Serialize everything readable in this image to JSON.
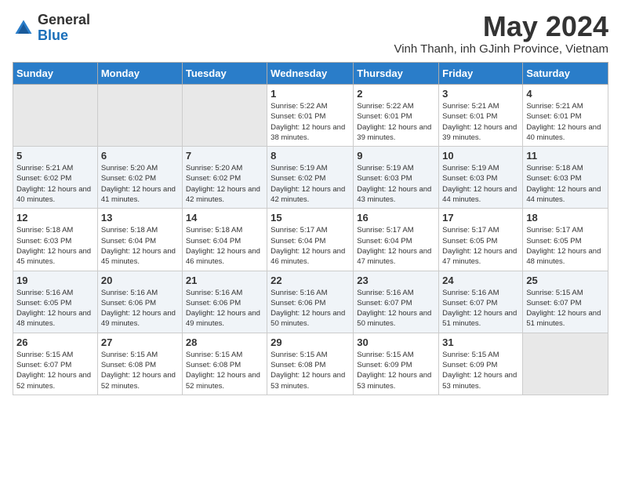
{
  "logo": {
    "general": "General",
    "blue": "Blue"
  },
  "header": {
    "month_title": "May 2024",
    "location": "Vinh Thanh, inh GJinh Province, Vietnam"
  },
  "weekdays": [
    "Sunday",
    "Monday",
    "Tuesday",
    "Wednesday",
    "Thursday",
    "Friday",
    "Saturday"
  ],
  "weeks": [
    [
      {
        "day": "",
        "sunrise": "",
        "sunset": "",
        "daylight": ""
      },
      {
        "day": "",
        "sunrise": "",
        "sunset": "",
        "daylight": ""
      },
      {
        "day": "",
        "sunrise": "",
        "sunset": "",
        "daylight": ""
      },
      {
        "day": "1",
        "sunrise": "Sunrise: 5:22 AM",
        "sunset": "Sunset: 6:01 PM",
        "daylight": "Daylight: 12 hours and 38 minutes."
      },
      {
        "day": "2",
        "sunrise": "Sunrise: 5:22 AM",
        "sunset": "Sunset: 6:01 PM",
        "daylight": "Daylight: 12 hours and 39 minutes."
      },
      {
        "day": "3",
        "sunrise": "Sunrise: 5:21 AM",
        "sunset": "Sunset: 6:01 PM",
        "daylight": "Daylight: 12 hours and 39 minutes."
      },
      {
        "day": "4",
        "sunrise": "Sunrise: 5:21 AM",
        "sunset": "Sunset: 6:01 PM",
        "daylight": "Daylight: 12 hours and 40 minutes."
      }
    ],
    [
      {
        "day": "5",
        "sunrise": "Sunrise: 5:21 AM",
        "sunset": "Sunset: 6:02 PM",
        "daylight": "Daylight: 12 hours and 40 minutes."
      },
      {
        "day": "6",
        "sunrise": "Sunrise: 5:20 AM",
        "sunset": "Sunset: 6:02 PM",
        "daylight": "Daylight: 12 hours and 41 minutes."
      },
      {
        "day": "7",
        "sunrise": "Sunrise: 5:20 AM",
        "sunset": "Sunset: 6:02 PM",
        "daylight": "Daylight: 12 hours and 42 minutes."
      },
      {
        "day": "8",
        "sunrise": "Sunrise: 5:19 AM",
        "sunset": "Sunset: 6:02 PM",
        "daylight": "Daylight: 12 hours and 42 minutes."
      },
      {
        "day": "9",
        "sunrise": "Sunrise: 5:19 AM",
        "sunset": "Sunset: 6:03 PM",
        "daylight": "Daylight: 12 hours and 43 minutes."
      },
      {
        "day": "10",
        "sunrise": "Sunrise: 5:19 AM",
        "sunset": "Sunset: 6:03 PM",
        "daylight": "Daylight: 12 hours and 44 minutes."
      },
      {
        "day": "11",
        "sunrise": "Sunrise: 5:18 AM",
        "sunset": "Sunset: 6:03 PM",
        "daylight": "Daylight: 12 hours and 44 minutes."
      }
    ],
    [
      {
        "day": "12",
        "sunrise": "Sunrise: 5:18 AM",
        "sunset": "Sunset: 6:03 PM",
        "daylight": "Daylight: 12 hours and 45 minutes."
      },
      {
        "day": "13",
        "sunrise": "Sunrise: 5:18 AM",
        "sunset": "Sunset: 6:04 PM",
        "daylight": "Daylight: 12 hours and 45 minutes."
      },
      {
        "day": "14",
        "sunrise": "Sunrise: 5:18 AM",
        "sunset": "Sunset: 6:04 PM",
        "daylight": "Daylight: 12 hours and 46 minutes."
      },
      {
        "day": "15",
        "sunrise": "Sunrise: 5:17 AM",
        "sunset": "Sunset: 6:04 PM",
        "daylight": "Daylight: 12 hours and 46 minutes."
      },
      {
        "day": "16",
        "sunrise": "Sunrise: 5:17 AM",
        "sunset": "Sunset: 6:04 PM",
        "daylight": "Daylight: 12 hours and 47 minutes."
      },
      {
        "day": "17",
        "sunrise": "Sunrise: 5:17 AM",
        "sunset": "Sunset: 6:05 PM",
        "daylight": "Daylight: 12 hours and 47 minutes."
      },
      {
        "day": "18",
        "sunrise": "Sunrise: 5:17 AM",
        "sunset": "Sunset: 6:05 PM",
        "daylight": "Daylight: 12 hours and 48 minutes."
      }
    ],
    [
      {
        "day": "19",
        "sunrise": "Sunrise: 5:16 AM",
        "sunset": "Sunset: 6:05 PM",
        "daylight": "Daylight: 12 hours and 48 minutes."
      },
      {
        "day": "20",
        "sunrise": "Sunrise: 5:16 AM",
        "sunset": "Sunset: 6:06 PM",
        "daylight": "Daylight: 12 hours and 49 minutes."
      },
      {
        "day": "21",
        "sunrise": "Sunrise: 5:16 AM",
        "sunset": "Sunset: 6:06 PM",
        "daylight": "Daylight: 12 hours and 49 minutes."
      },
      {
        "day": "22",
        "sunrise": "Sunrise: 5:16 AM",
        "sunset": "Sunset: 6:06 PM",
        "daylight": "Daylight: 12 hours and 50 minutes."
      },
      {
        "day": "23",
        "sunrise": "Sunrise: 5:16 AM",
        "sunset": "Sunset: 6:07 PM",
        "daylight": "Daylight: 12 hours and 50 minutes."
      },
      {
        "day": "24",
        "sunrise": "Sunrise: 5:16 AM",
        "sunset": "Sunset: 6:07 PM",
        "daylight": "Daylight: 12 hours and 51 minutes."
      },
      {
        "day": "25",
        "sunrise": "Sunrise: 5:15 AM",
        "sunset": "Sunset: 6:07 PM",
        "daylight": "Daylight: 12 hours and 51 minutes."
      }
    ],
    [
      {
        "day": "26",
        "sunrise": "Sunrise: 5:15 AM",
        "sunset": "Sunset: 6:07 PM",
        "daylight": "Daylight: 12 hours and 52 minutes."
      },
      {
        "day": "27",
        "sunrise": "Sunrise: 5:15 AM",
        "sunset": "Sunset: 6:08 PM",
        "daylight": "Daylight: 12 hours and 52 minutes."
      },
      {
        "day": "28",
        "sunrise": "Sunrise: 5:15 AM",
        "sunset": "Sunset: 6:08 PM",
        "daylight": "Daylight: 12 hours and 52 minutes."
      },
      {
        "day": "29",
        "sunrise": "Sunrise: 5:15 AM",
        "sunset": "Sunset: 6:08 PM",
        "daylight": "Daylight: 12 hours and 53 minutes."
      },
      {
        "day": "30",
        "sunrise": "Sunrise: 5:15 AM",
        "sunset": "Sunset: 6:09 PM",
        "daylight": "Daylight: 12 hours and 53 minutes."
      },
      {
        "day": "31",
        "sunrise": "Sunrise: 5:15 AM",
        "sunset": "Sunset: 6:09 PM",
        "daylight": "Daylight: 12 hours and 53 minutes."
      },
      {
        "day": "",
        "sunrise": "",
        "sunset": "",
        "daylight": ""
      }
    ]
  ]
}
